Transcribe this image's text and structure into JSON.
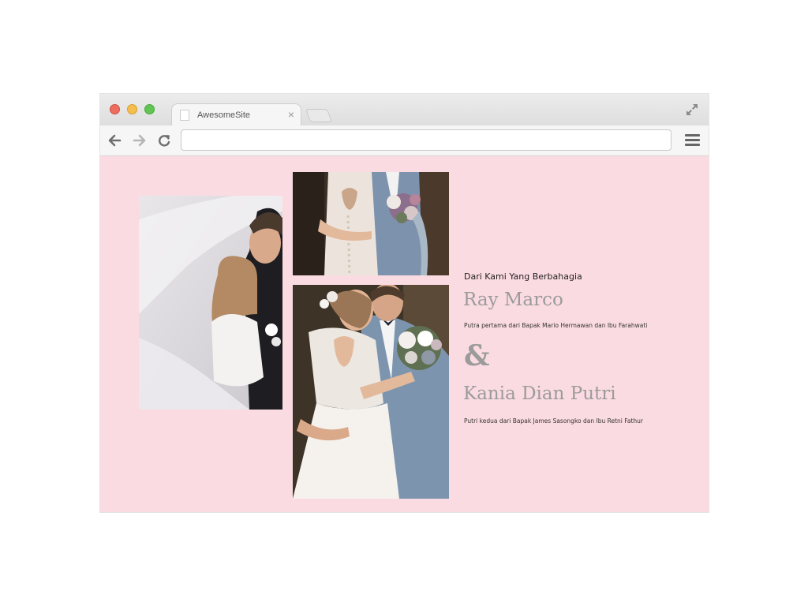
{
  "browser": {
    "tab_title": "AwesomeSite",
    "tab_close": "×",
    "address_value": "",
    "window_controls": [
      "close-red",
      "minimize-yellow",
      "maximize-green"
    ],
    "icons": {
      "back": "arrow-left-icon",
      "forward": "arrow-right-icon",
      "reload": "reload-icon",
      "menu": "hamburger-menu-icon",
      "expand": "expand-icon"
    }
  },
  "page": {
    "background": "#fbdbe2",
    "intro": "Dari Kami Yang Berbahagia",
    "groom_name": "Ray Marco",
    "groom_parents": "Putra pertama dari Bapak Mario Hermawan dan Ibu Farahwati",
    "ampersand": "&",
    "bride_name": "Kania Dian Putri",
    "bride_parents": "Putri kedua dari Bapak James Sasongko dan Ibu Retni Fathur",
    "name_color": "#9b9b9b"
  },
  "photos": [
    {
      "name": "couple-veil-kiss-photo"
    },
    {
      "name": "couple-back-view-bouquet-photo"
    },
    {
      "name": "couple-embrace-bouquet-photo"
    }
  ]
}
